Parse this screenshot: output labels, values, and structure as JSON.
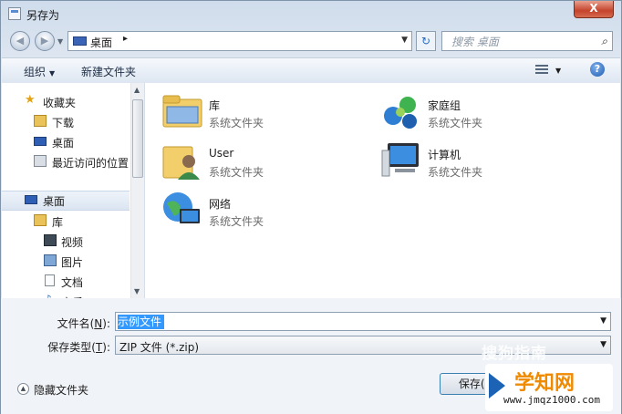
{
  "window": {
    "title": "另存为",
    "close_symbol": "X"
  },
  "address": {
    "location": "桌面",
    "separator": "▸"
  },
  "search": {
    "placeholder": "搜索 桌面"
  },
  "toolbar": {
    "organize": "组织",
    "new_folder": "新建文件夹"
  },
  "sidebar": {
    "favorites_header": "收藏夹",
    "items": [
      {
        "label": "下载",
        "icon": "download-folder-icon"
      },
      {
        "label": "桌面",
        "icon": "desktop-icon"
      },
      {
        "label": "最近访问的位置",
        "icon": "recent-places-icon"
      }
    ],
    "desktop_header": "桌面",
    "tree": [
      {
        "label": "库",
        "icon": "library-icon"
      },
      {
        "label": "视频",
        "icon": "video-icon"
      },
      {
        "label": "图片",
        "icon": "picture-icon"
      },
      {
        "label": "文档",
        "icon": "document-icon"
      },
      {
        "label": "音乐",
        "icon": "music-icon"
      }
    ]
  },
  "content": {
    "items": [
      {
        "name": "库",
        "type": "系统文件夹",
        "icon": "library-folder-icon"
      },
      {
        "name": "家庭组",
        "type": "系统文件夹",
        "icon": "homegroup-icon"
      },
      {
        "name": "User",
        "type": "系统文件夹",
        "icon": "user-folder-icon"
      },
      {
        "name": "计算机",
        "type": "系统文件夹",
        "icon": "computer-icon"
      },
      {
        "name": "网络",
        "type": "系统文件夹",
        "icon": "network-icon"
      }
    ]
  },
  "form": {
    "filename_label": "文件名(",
    "filename_key": "N",
    "filename_suffix": "):",
    "filename_value": "示例文件",
    "filetype_label": "保存类型(",
    "filetype_key": "T",
    "filetype_suffix": "):",
    "filetype_value": "ZIP 文件 (*.zip)"
  },
  "bottom": {
    "hide_folders": "隐藏文件夹",
    "save_label": "保存(S"
  },
  "watermark": {
    "sogou": "搜狗指南",
    "brand": "学知网",
    "url": "www.jmqz1000.com"
  },
  "colors": {
    "selection": "#3399ff",
    "brand_orange": "#f08a00",
    "close_red": "#c5432b"
  }
}
